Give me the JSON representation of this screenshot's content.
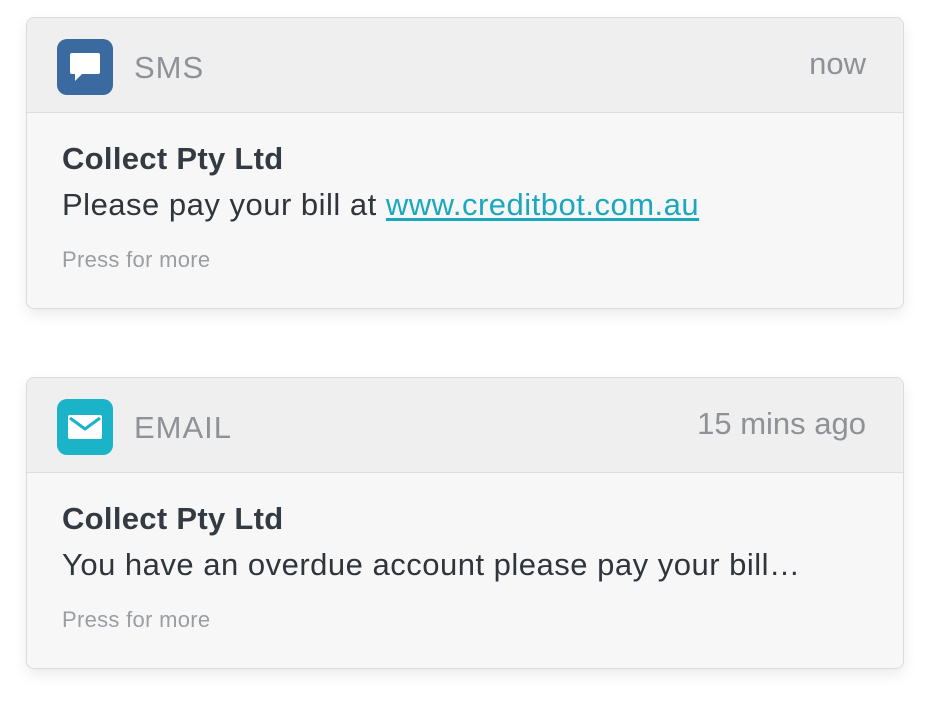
{
  "notifications": [
    {
      "app_label": "SMS",
      "icon": "chat-bubble-icon",
      "icon_color": "#3b6aa0",
      "time": "now",
      "sender": "Collect Pty Ltd",
      "message_prefix": "Please pay your bill at ",
      "message_link": "www.creditbot.com.au",
      "more_label": "Press for more"
    },
    {
      "app_label": "EMAIL",
      "icon": "envelope-icon",
      "icon_color": "#1ab3c7",
      "time": "15 mins ago",
      "sender": "Collect Pty Ltd",
      "message": "You have an overdue account please pay your bill…",
      "more_label": "Press for more"
    }
  ],
  "colors": {
    "link": "#1ba8bf",
    "card_background": "#f7f7f7",
    "header_background": "#efefef"
  }
}
